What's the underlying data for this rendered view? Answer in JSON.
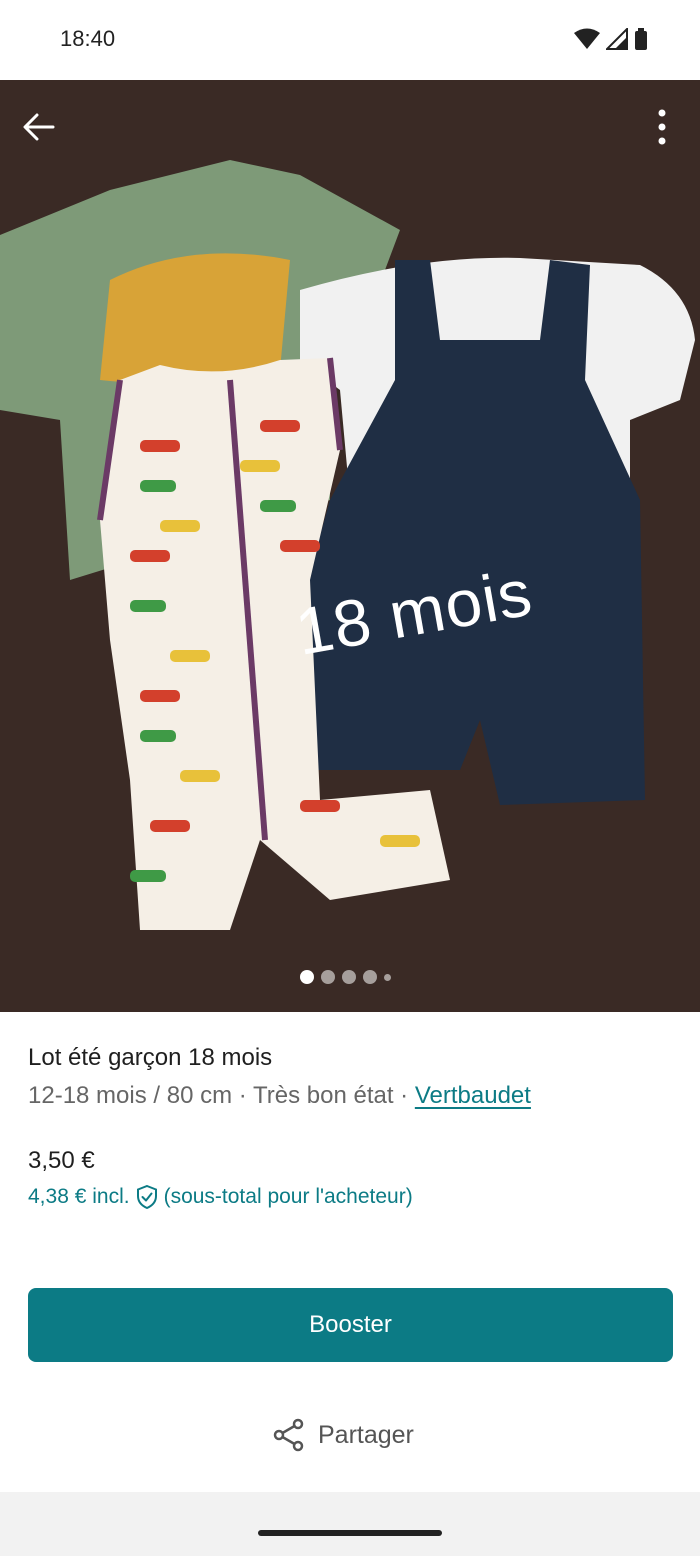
{
  "status_bar": {
    "time": "18:40"
  },
  "listing": {
    "photo_overlay_text": "18 mois",
    "carousel": {
      "total": 5,
      "active_index": 0
    },
    "title": "Lot été garçon 18 mois",
    "meta": "12-18 mois / 80 cm · Très bon état · ",
    "brand": "Vertbaudet",
    "price": "3,50 €",
    "total_price": "4,38 € incl.",
    "total_note": "(sous-total pour l'acheteur)"
  },
  "actions": {
    "booster_label": "Booster",
    "share_label": "Partager"
  },
  "colors": {
    "accent": "#0c7b85",
    "photo_background": "#3b2a24"
  },
  "icons": [
    "wifi-icon",
    "signal-icon",
    "battery-icon",
    "back-arrow-icon",
    "more-vertical-icon",
    "shield-check-icon",
    "share-icon"
  ]
}
